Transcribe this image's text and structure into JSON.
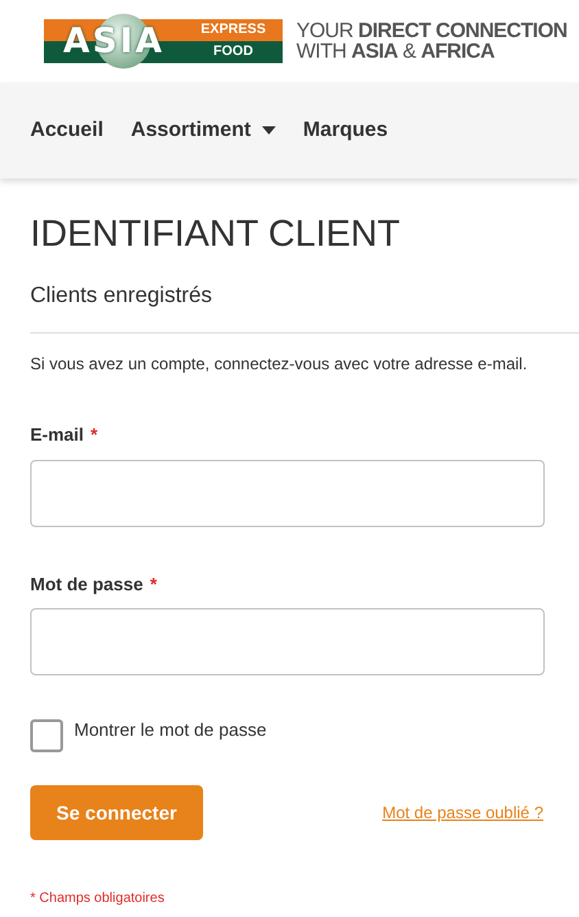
{
  "logo": {
    "brand": "ASIA",
    "line_1": "EXPRESS",
    "line_2": "FOOD"
  },
  "tagline": {
    "line_1_light": "YOUR",
    "line_1_bold": "DIRECT CONNECTION",
    "line_2_light": "WITH",
    "line_2_bold": "ASIA",
    "line_2_amp": "&",
    "line_2_bold_2": "AFRICA"
  },
  "nav": [
    {
      "label": "Accueil",
      "dropdown": false
    },
    {
      "label": "Assortiment",
      "dropdown": true
    },
    {
      "label": "Marques",
      "dropdown": false
    }
  ],
  "title": "IDENTIFIANT CLIENT",
  "section_title": "Clients enregistrés",
  "intro": "Si vous avez un compte, connectez-vous avec votre adresse e-mail.",
  "fields": [
    {
      "label": "E-mail",
      "required_mark": "*"
    },
    {
      "label": "Mot de passe",
      "required_mark": "*"
    }
  ],
  "show_password": {
    "label": "Montrer le mot de passe",
    "checked": false
  },
  "submit_button": "Se connecter",
  "forgot_link": "Mot de passe oublié ?",
  "required_note": "* Champs obligatoires"
}
